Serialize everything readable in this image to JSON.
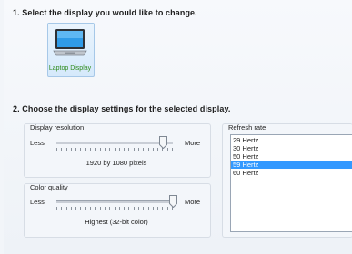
{
  "section1": {
    "heading": "1. Select the display you would like to change."
  },
  "display": {
    "label": "Laptop Display",
    "icon": "laptop-icon"
  },
  "section2": {
    "heading": "2. Choose the display settings for the selected display."
  },
  "resolution": {
    "title": "Display resolution",
    "min_label": "Less",
    "max_label": "More",
    "value_text": "1920 by 1080 pixels",
    "position": 0.92
  },
  "color_quality": {
    "title": "Color quality",
    "min_label": "Less",
    "max_label": "More",
    "value_text": "Highest (32-bit color)",
    "position": 1.0
  },
  "refresh_rate": {
    "title": "Refresh rate",
    "options": [
      {
        "label": "29 Hertz",
        "selected": false
      },
      {
        "label": "30 Hertz",
        "selected": false
      },
      {
        "label": "50 Hertz",
        "selected": false
      },
      {
        "label": "59 Hertz",
        "selected": true
      },
      {
        "label": "60 Hertz",
        "selected": false
      }
    ]
  },
  "colors": {
    "accent": "#3399ff",
    "display_label": "#2c8a1b"
  }
}
